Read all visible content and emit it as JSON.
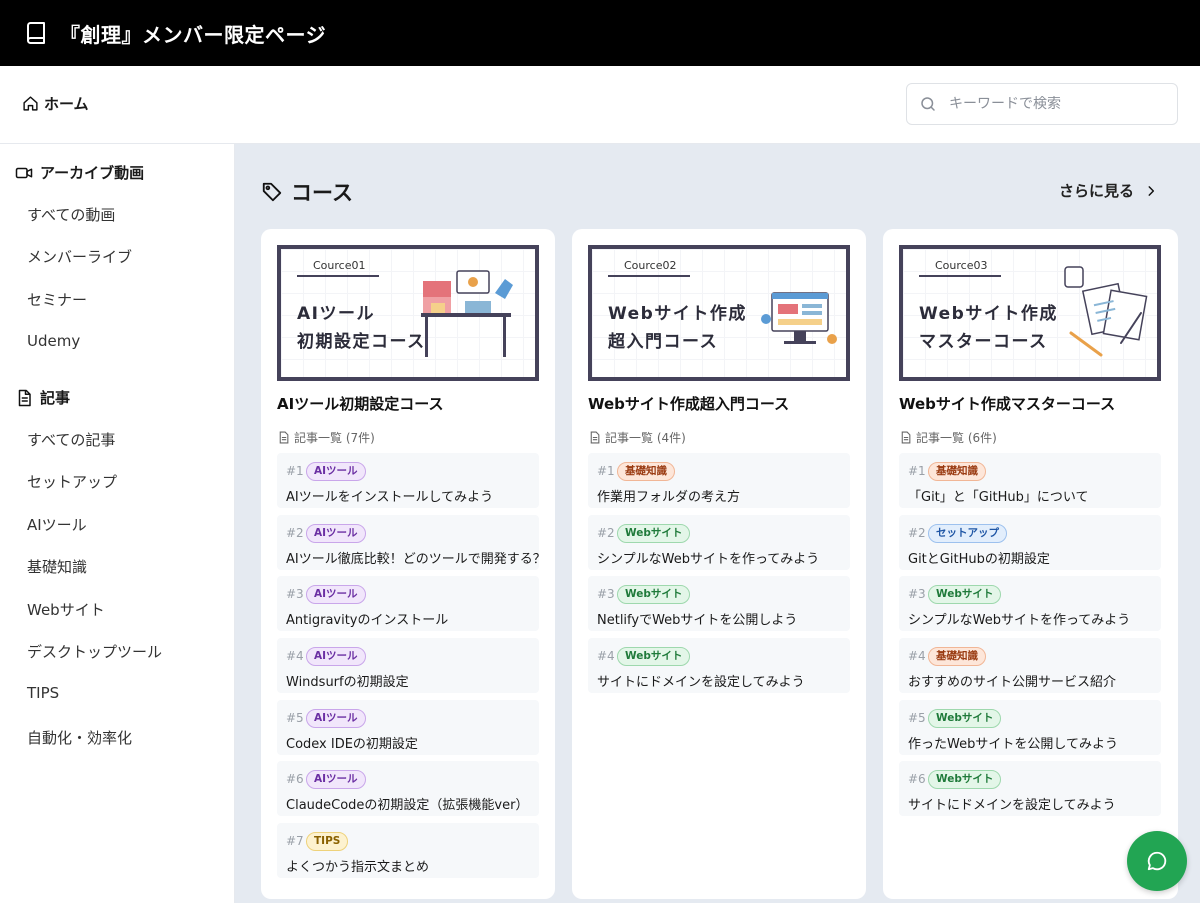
{
  "app": {
    "title": "『創理』メンバー限定ページ",
    "icon": "book-icon"
  },
  "nav": {
    "home_label": "ホーム",
    "home_icon": "home-icon"
  },
  "search": {
    "placeholder": "キーワードで検索",
    "value": "",
    "icon": "search-icon"
  },
  "sidebar": {
    "sections": [
      {
        "title": "アーカイブ動画",
        "icon": "video-icon",
        "items": [
          {
            "label": "すべての動画"
          },
          {
            "label": "メンバーライブ"
          },
          {
            "label": "セミナー"
          },
          {
            "label": "Udemy"
          }
        ]
      },
      {
        "title": "記事",
        "icon": "document-icon",
        "items": [
          {
            "label": "すべての記事"
          },
          {
            "label": "セットアップ"
          },
          {
            "label": "AIツール"
          },
          {
            "label": "基礎知識"
          },
          {
            "label": "Webサイト"
          },
          {
            "label": "デスクトップツール"
          },
          {
            "label": "TIPS"
          },
          {
            "label": "自動化・効率化"
          }
        ]
      }
    ]
  },
  "main": {
    "section_title": "コース",
    "section_icon": "tag-icon",
    "more_label": "さらに見る",
    "courses": [
      {
        "banner_tag": "Cource01",
        "banner_line1": "AIツール",
        "banner_line2": "初期設定コース",
        "title": "AIツール初期設定コース",
        "count_label": "記事一覧 (7件)",
        "articles": [
          {
            "num": "#1",
            "tag": "AIツール",
            "title": "AIツールをインストールしてみよう"
          },
          {
            "num": "#2",
            "tag": "AIツール",
            "title": "AIツール徹底比較！どのツールで開発する？"
          },
          {
            "num": "#3",
            "tag": "AIツール",
            "title": "Antigravityのインストール"
          },
          {
            "num": "#4",
            "tag": "AIツール",
            "title": "Windsurfの初期設定"
          },
          {
            "num": "#5",
            "tag": "AIツール",
            "title": "Codex IDEの初期設定"
          },
          {
            "num": "#6",
            "tag": "AIツール",
            "title": "ClaudeCodeの初期設定（拡張機能ver）"
          },
          {
            "num": "#7",
            "tag": "TIPS",
            "title": "よくつかう指示文まとめ"
          }
        ]
      },
      {
        "banner_tag": "Cource02",
        "banner_line1": "Webサイト作成",
        "banner_line2": "超入門コース",
        "title": "Webサイト作成超入門コース",
        "count_label": "記事一覧 (4件)",
        "articles": [
          {
            "num": "#1",
            "tag": "基礎知識",
            "title": "作業用フォルダの考え方"
          },
          {
            "num": "#2",
            "tag": "Webサイト",
            "title": "シンプルなWebサイトを作ってみよう"
          },
          {
            "num": "#3",
            "tag": "Webサイト",
            "title": "NetlifyでWebサイトを公開しよう"
          },
          {
            "num": "#4",
            "tag": "Webサイト",
            "title": "サイトにドメインを設定してみよう"
          }
        ]
      },
      {
        "banner_tag": "Cource03",
        "banner_line1": "Webサイト作成",
        "banner_line2": "マスターコース",
        "title": "Webサイト作成マスターコース",
        "count_label": "記事一覧 (6件)",
        "articles": [
          {
            "num": "#1",
            "tag": "基礎知識",
            "title": "「Git」と「GitHub」について"
          },
          {
            "num": "#2",
            "tag": "セットアップ",
            "title": "GitとGitHubの初期設定"
          },
          {
            "num": "#3",
            "tag": "Webサイト",
            "title": "シンプルなWebサイトを作ってみよう"
          },
          {
            "num": "#4",
            "tag": "基礎知識",
            "title": "おすすめのサイト公開サービス紹介"
          },
          {
            "num": "#5",
            "tag": "Webサイト",
            "title": "作ったWebサイトを公開してみよう"
          },
          {
            "num": "#6",
            "tag": "Webサイト",
            "title": "サイトにドメインを設定してみよう"
          }
        ]
      }
    ]
  },
  "tag_colors": {
    "AIツール": "#6b2fa3",
    "基礎知識": "#9a3b12",
    "Webサイト": "#1f7a3a",
    "セットアップ": "#1f56a5",
    "TIPS": "#8a6100"
  },
  "chat": {
    "icon": "chat-icon",
    "color": "#22a553"
  }
}
